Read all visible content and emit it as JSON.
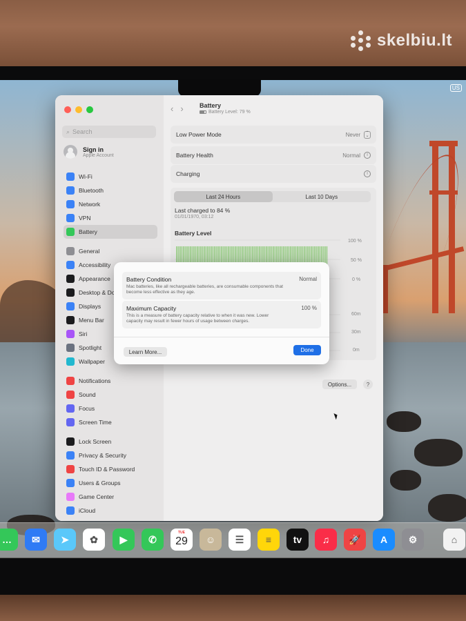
{
  "watermark": "skelbiu.lt",
  "menubar": {
    "input_badge": "US"
  },
  "window": {
    "title": "Battery",
    "subtitle": "Battery Level: 79 %",
    "search_placeholder": "Search",
    "account": {
      "name": "Sign in",
      "sub": "Apple Account"
    },
    "sidebar": [
      {
        "label": "Wi-Fi",
        "icon": "wifi-icon",
        "color": "#3b82f6"
      },
      {
        "label": "Bluetooth",
        "icon": "bluetooth-icon",
        "color": "#3b82f6"
      },
      {
        "label": "Network",
        "icon": "globe-icon",
        "color": "#3b82f6"
      },
      {
        "label": "VPN",
        "icon": "vpn-icon",
        "color": "#3b82f6"
      },
      {
        "label": "Battery",
        "icon": "battery-icon",
        "color": "#34c759",
        "active": true
      },
      {
        "label": "General",
        "icon": "gear-icon",
        "color": "#8e8e93"
      },
      {
        "label": "Accessibility",
        "icon": "accessibility-icon",
        "color": "#3b82f6"
      },
      {
        "label": "Appearance",
        "icon": "appearance-icon",
        "color": "#1c1c1e"
      },
      {
        "label": "Desktop & Dock",
        "icon": "dock-icon",
        "color": "#1c1c1e"
      },
      {
        "label": "Displays",
        "icon": "display-icon",
        "color": "#3b82f6"
      },
      {
        "label": "Menu Bar",
        "icon": "menubar-icon",
        "color": "#1c1c1e"
      },
      {
        "label": "Siri",
        "icon": "siri-icon",
        "color": "#a855f7"
      },
      {
        "label": "Spotlight",
        "icon": "spotlight-icon",
        "color": "#6b7280"
      },
      {
        "label": "Wallpaper",
        "icon": "wallpaper-icon",
        "color": "#22b8cf"
      },
      {
        "label": "Notifications",
        "icon": "bell-icon",
        "color": "#ef4444"
      },
      {
        "label": "Sound",
        "icon": "speaker-icon",
        "color": "#ef4444"
      },
      {
        "label": "Focus",
        "icon": "moon-icon",
        "color": "#6366f1"
      },
      {
        "label": "Screen Time",
        "icon": "hourglass-icon",
        "color": "#6366f1"
      },
      {
        "label": "Lock Screen",
        "icon": "lock-icon",
        "color": "#1c1c1e"
      },
      {
        "label": "Privacy & Security",
        "icon": "hand-icon",
        "color": "#3b82f6"
      },
      {
        "label": "Touch ID & Password",
        "icon": "fingerprint-icon",
        "color": "#ef4444"
      },
      {
        "label": "Users & Groups",
        "icon": "users-icon",
        "color": "#3b82f6"
      },
      {
        "label": "Game Center",
        "icon": "gamecenter-icon",
        "color": "#e879f9"
      },
      {
        "label": "iCloud",
        "icon": "cloud-icon",
        "color": "#3b82f6"
      }
    ],
    "settings": {
      "low_power_label": "Low Power Mode",
      "low_power_value": "Never",
      "health_label": "Battery Health",
      "health_value": "Normal",
      "charging_label": "Charging"
    },
    "usage": {
      "tabs": [
        "Last 24 Hours",
        "Last 10 Days"
      ],
      "last_charged": "Last charged to 84 %",
      "last_charged_time": "01/01/1970, 03:12",
      "chart_title": "Battery Level",
      "y_ticks_level": [
        "100 %",
        "50 %",
        "0 %"
      ],
      "y_ticks_usage": [
        "60m",
        "30m",
        "0m"
      ],
      "level_percent": 84
    },
    "options_label": "Options...",
    "help_label": "?"
  },
  "dialog": {
    "condition_title": "Battery Condition",
    "condition_value": "Normal",
    "condition_text": "Mac batteries, like all rechargeable batteries, are consumable components that become less effective as they age.",
    "capacity_title": "Maximum Capacity",
    "capacity_value": "100 %",
    "capacity_text": "This is a measure of battery capacity relative to when it was new. Lower capacity may result in fewer hours of usage between charges.",
    "learn_more": "Learn More...",
    "done": "Done"
  },
  "dock": {
    "calendar_month": "TUE",
    "calendar_day": "29",
    "apps": [
      {
        "name": "messages-icon",
        "color": "#34c759",
        "glyph": "…"
      },
      {
        "name": "mail-icon",
        "color": "#2f7bf5",
        "glyph": "✉"
      },
      {
        "name": "maps-icon",
        "color": "#5ac8fa",
        "glyph": "➤"
      },
      {
        "name": "photos-icon",
        "color": "#ffffff",
        "glyph": "✿"
      },
      {
        "name": "facetime-icon",
        "color": "#34c759",
        "glyph": "▶"
      },
      {
        "name": "phone-icon",
        "color": "#34c759",
        "glyph": "✆"
      },
      {
        "name": "calendar-icon",
        "color": "#ffffff",
        "glyph": ""
      },
      {
        "name": "contacts-icon",
        "color": "#c8b89a",
        "glyph": "☺"
      },
      {
        "name": "reminders-icon",
        "color": "#ffffff",
        "glyph": "☰"
      },
      {
        "name": "notes-icon",
        "color": "#ffd60a",
        "glyph": "≡"
      },
      {
        "name": "tv-icon",
        "color": "#111111",
        "glyph": "tv"
      },
      {
        "name": "music-icon",
        "color": "#fa2d48",
        "glyph": "♫"
      },
      {
        "name": "launchpad-icon",
        "color": "#ef4444",
        "glyph": "🚀"
      },
      {
        "name": "app-store-icon",
        "color": "#1a8cff",
        "glyph": "A"
      },
      {
        "name": "system-settings-icon",
        "color": "#8e8e93",
        "glyph": "⚙"
      },
      {
        "name": "home-icon",
        "color": "#f2f2f2",
        "glyph": "⌂"
      }
    ]
  }
}
